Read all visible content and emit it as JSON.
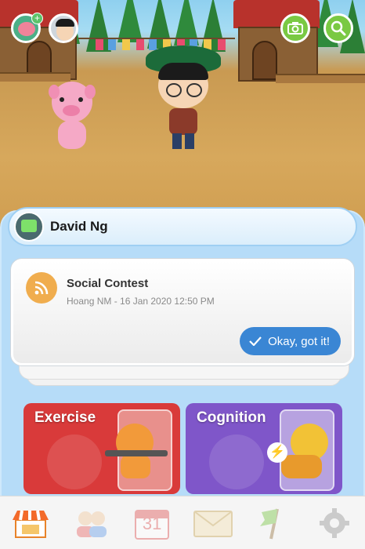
{
  "header": {
    "user_avatar": "pig-avatar-icon",
    "friend_avatar": "boy-avatar-icon",
    "camera_button": "camera-icon",
    "search_button": "search-icon"
  },
  "profile": {
    "name": "David Ng"
  },
  "notification": {
    "icon": "rss-feed-icon",
    "title": "Social Contest",
    "meta": "Hoang NM - 16 Jan 2020 12:50 PM",
    "confirm_label": "Okay, got it!"
  },
  "activities": [
    {
      "label": "Exercise",
      "color": "#d93a3a"
    },
    {
      "label": "Cognition",
      "color": "#7f56c9"
    }
  ],
  "bottom_nav": {
    "items": [
      {
        "name": "shop-icon"
      },
      {
        "name": "friends-icon"
      },
      {
        "name": "calendar-icon",
        "label": "31"
      },
      {
        "name": "mail-icon"
      },
      {
        "name": "flag-icon"
      },
      {
        "name": "settings-icon"
      }
    ]
  },
  "colors": {
    "accent_blue": "#3a86d4",
    "panel_blue": "#b6dcf8",
    "button_green": "#7ac943",
    "feed_orange": "#f0ad4e"
  }
}
